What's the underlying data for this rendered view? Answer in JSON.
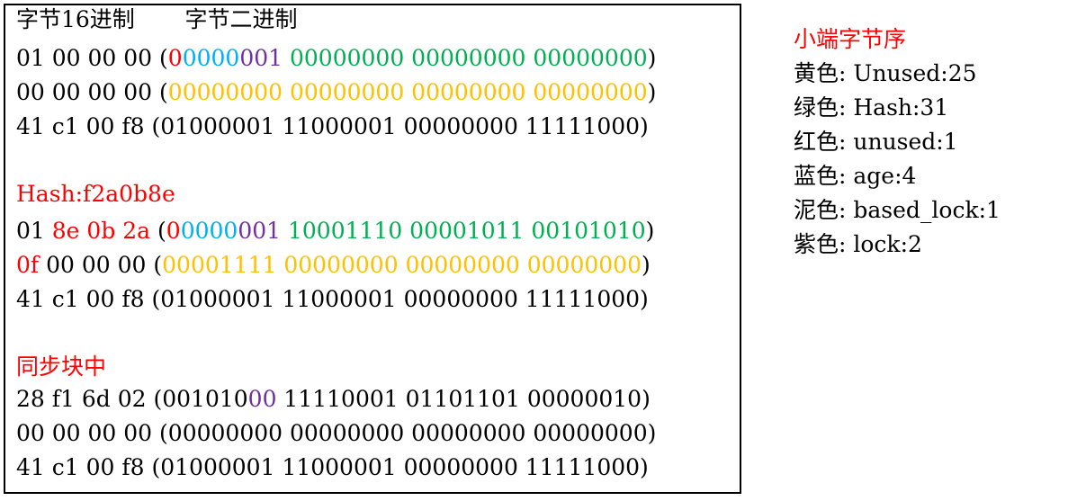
{
  "colors": {
    "black": "#000000",
    "red": "#ff0000",
    "blue": "#00b0f0",
    "purple": "#7030a0",
    "green": "#00b050",
    "yellow": "#ffc000"
  },
  "main": {
    "header": [
      {
        "t": "字节16进制       字节二进制",
        "c": "black"
      }
    ],
    "section1": [
      [
        {
          "t": "01 00 00 00 (",
          "c": "black"
        },
        {
          "t": "0",
          "c": "red"
        },
        {
          "t": "0000",
          "c": "blue"
        },
        {
          "t": "001",
          "c": "purple"
        },
        {
          "t": " 00000000 00000000 00000000",
          "c": "green"
        },
        {
          "t": ")",
          "c": "black"
        }
      ],
      [
        {
          "t": "00 00 00 00 (",
          "c": "black"
        },
        {
          "t": "00000000 00000000 00000000 00000000",
          "c": "yellow"
        },
        {
          "t": ")",
          "c": "black"
        }
      ],
      [
        {
          "t": "41 c1 00 f8 (01000001 11000001 00000000 11111000)",
          "c": "black"
        }
      ]
    ],
    "hash_title": [
      {
        "t": "Hash:f2a0b8e",
        "c": "red"
      }
    ],
    "section2": [
      [
        {
          "t": "01 ",
          "c": "black"
        },
        {
          "t": "8e 0b 2a",
          "c": "red"
        },
        {
          "t": " (",
          "c": "black"
        },
        {
          "t": "0",
          "c": "red"
        },
        {
          "t": "0000",
          "c": "blue"
        },
        {
          "t": "001",
          "c": "purple"
        },
        {
          "t": " 10001110 00001011 00101010",
          "c": "green"
        },
        {
          "t": ")",
          "c": "black"
        }
      ],
      [
        {
          "t": "0f",
          "c": "red"
        },
        {
          "t": " 00 00 00 (",
          "c": "black"
        },
        {
          "t": "00001111 00000000 00000000 00000000",
          "c": "yellow"
        },
        {
          "t": ")",
          "c": "black"
        }
      ],
      [
        {
          "t": "41 c1 00 f8 (01000001 11000001 00000000 11111000)",
          "c": "black"
        }
      ]
    ],
    "sync_title": [
      {
        "t": "同步块中",
        "c": "red"
      }
    ],
    "section3": [
      [
        {
          "t": "28 f1 6d 02 (001010",
          "c": "black"
        },
        {
          "t": "00",
          "c": "purple"
        },
        {
          "t": " 11110001 01101101 00000010)",
          "c": "black"
        }
      ],
      [
        {
          "t": "00 00 00 00 (00000000 00000000 00000000 00000000)",
          "c": "black"
        }
      ],
      [
        {
          "t": "41 c1 00 f8 (01000001 11000001 00000000 11111000)",
          "c": "black"
        }
      ]
    ]
  },
  "legend": {
    "title": "小端字节序",
    "items": [
      "黄色: Unused:25",
      "绿色: Hash:31",
      "红色: unused:1",
      "蓝色: age:4",
      "泥色: based_lock:1",
      "紫色: lock:2"
    ]
  }
}
